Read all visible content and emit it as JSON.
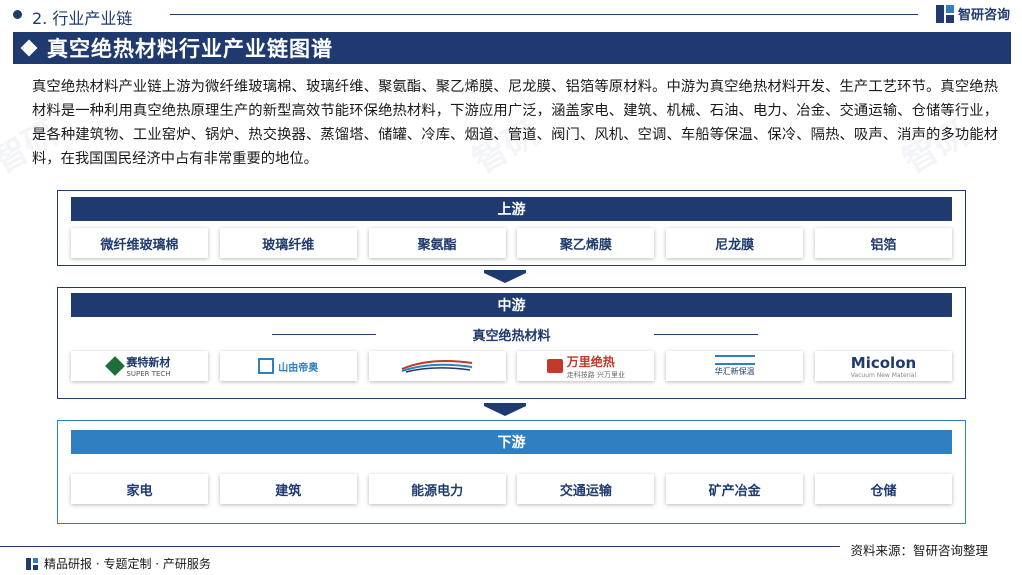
{
  "header": {
    "section": "2. 行业产业链",
    "brand": "智研咨询"
  },
  "title": "真空绝热材料行业产业链图谱",
  "intro": "真空绝热材料产业链上游为微纤维玻璃棉、玻璃纤维、聚氨酯、聚乙烯膜、尼龙膜、铝箔等原材料。中游为真空绝热材料开发、生产工艺环节。真空绝热材料是一种利用真空绝热原理生产的新型高效节能环保绝热材料，下游应用广泛，涵盖家电、建筑、机械、石油、电力、冶金、交通运输、仓储等行业，是各种建筑物、工业窑炉、锅炉、热交换器、蒸馏塔、储罐、冷库、烟道、管道、阀门、风机、空调、车船等保温、保冷、隔热、吸声、消声的多功能材料，在我国国民经济中占有非常重要的地位。",
  "upstream": {
    "label": "上游",
    "items": [
      "微纤维玻璃棉",
      "玻璃纤维",
      "聚氨酯",
      "聚乙烯膜",
      "尼龙膜",
      "铝箔"
    ]
  },
  "midstream": {
    "label": "中游",
    "subtitle": "真空绝热材料",
    "logos": [
      {
        "icon": "saite-logo-icon",
        "name": "赛特新材",
        "en": "SUPER TECH"
      },
      {
        "icon": "shanwu-logo-icon",
        "name": "山由帝奥"
      },
      {
        "icon": "swoosh-logo-icon"
      },
      {
        "icon": "wanli-logo-icon",
        "name": "万里绝热",
        "sub": "走科技路   兴万里业"
      },
      {
        "icon": "hh-logo-icon",
        "name": "华汇新保温"
      },
      {
        "icon": "micolon-logo-icon",
        "name": "Micolon",
        "en": "Vacuum New Material"
      }
    ]
  },
  "downstream": {
    "label": "下游",
    "items": [
      "家电",
      "建筑",
      "能源电力",
      "交通运输",
      "矿产冶金",
      "仓储"
    ]
  },
  "footer": {
    "source": "资料来源：智研咨询整理",
    "services": "精品研报 · 专题定制 · 产研服务"
  },
  "colors": {
    "navy": "#1f3a6e",
    "blue": "#2f7fc1"
  }
}
